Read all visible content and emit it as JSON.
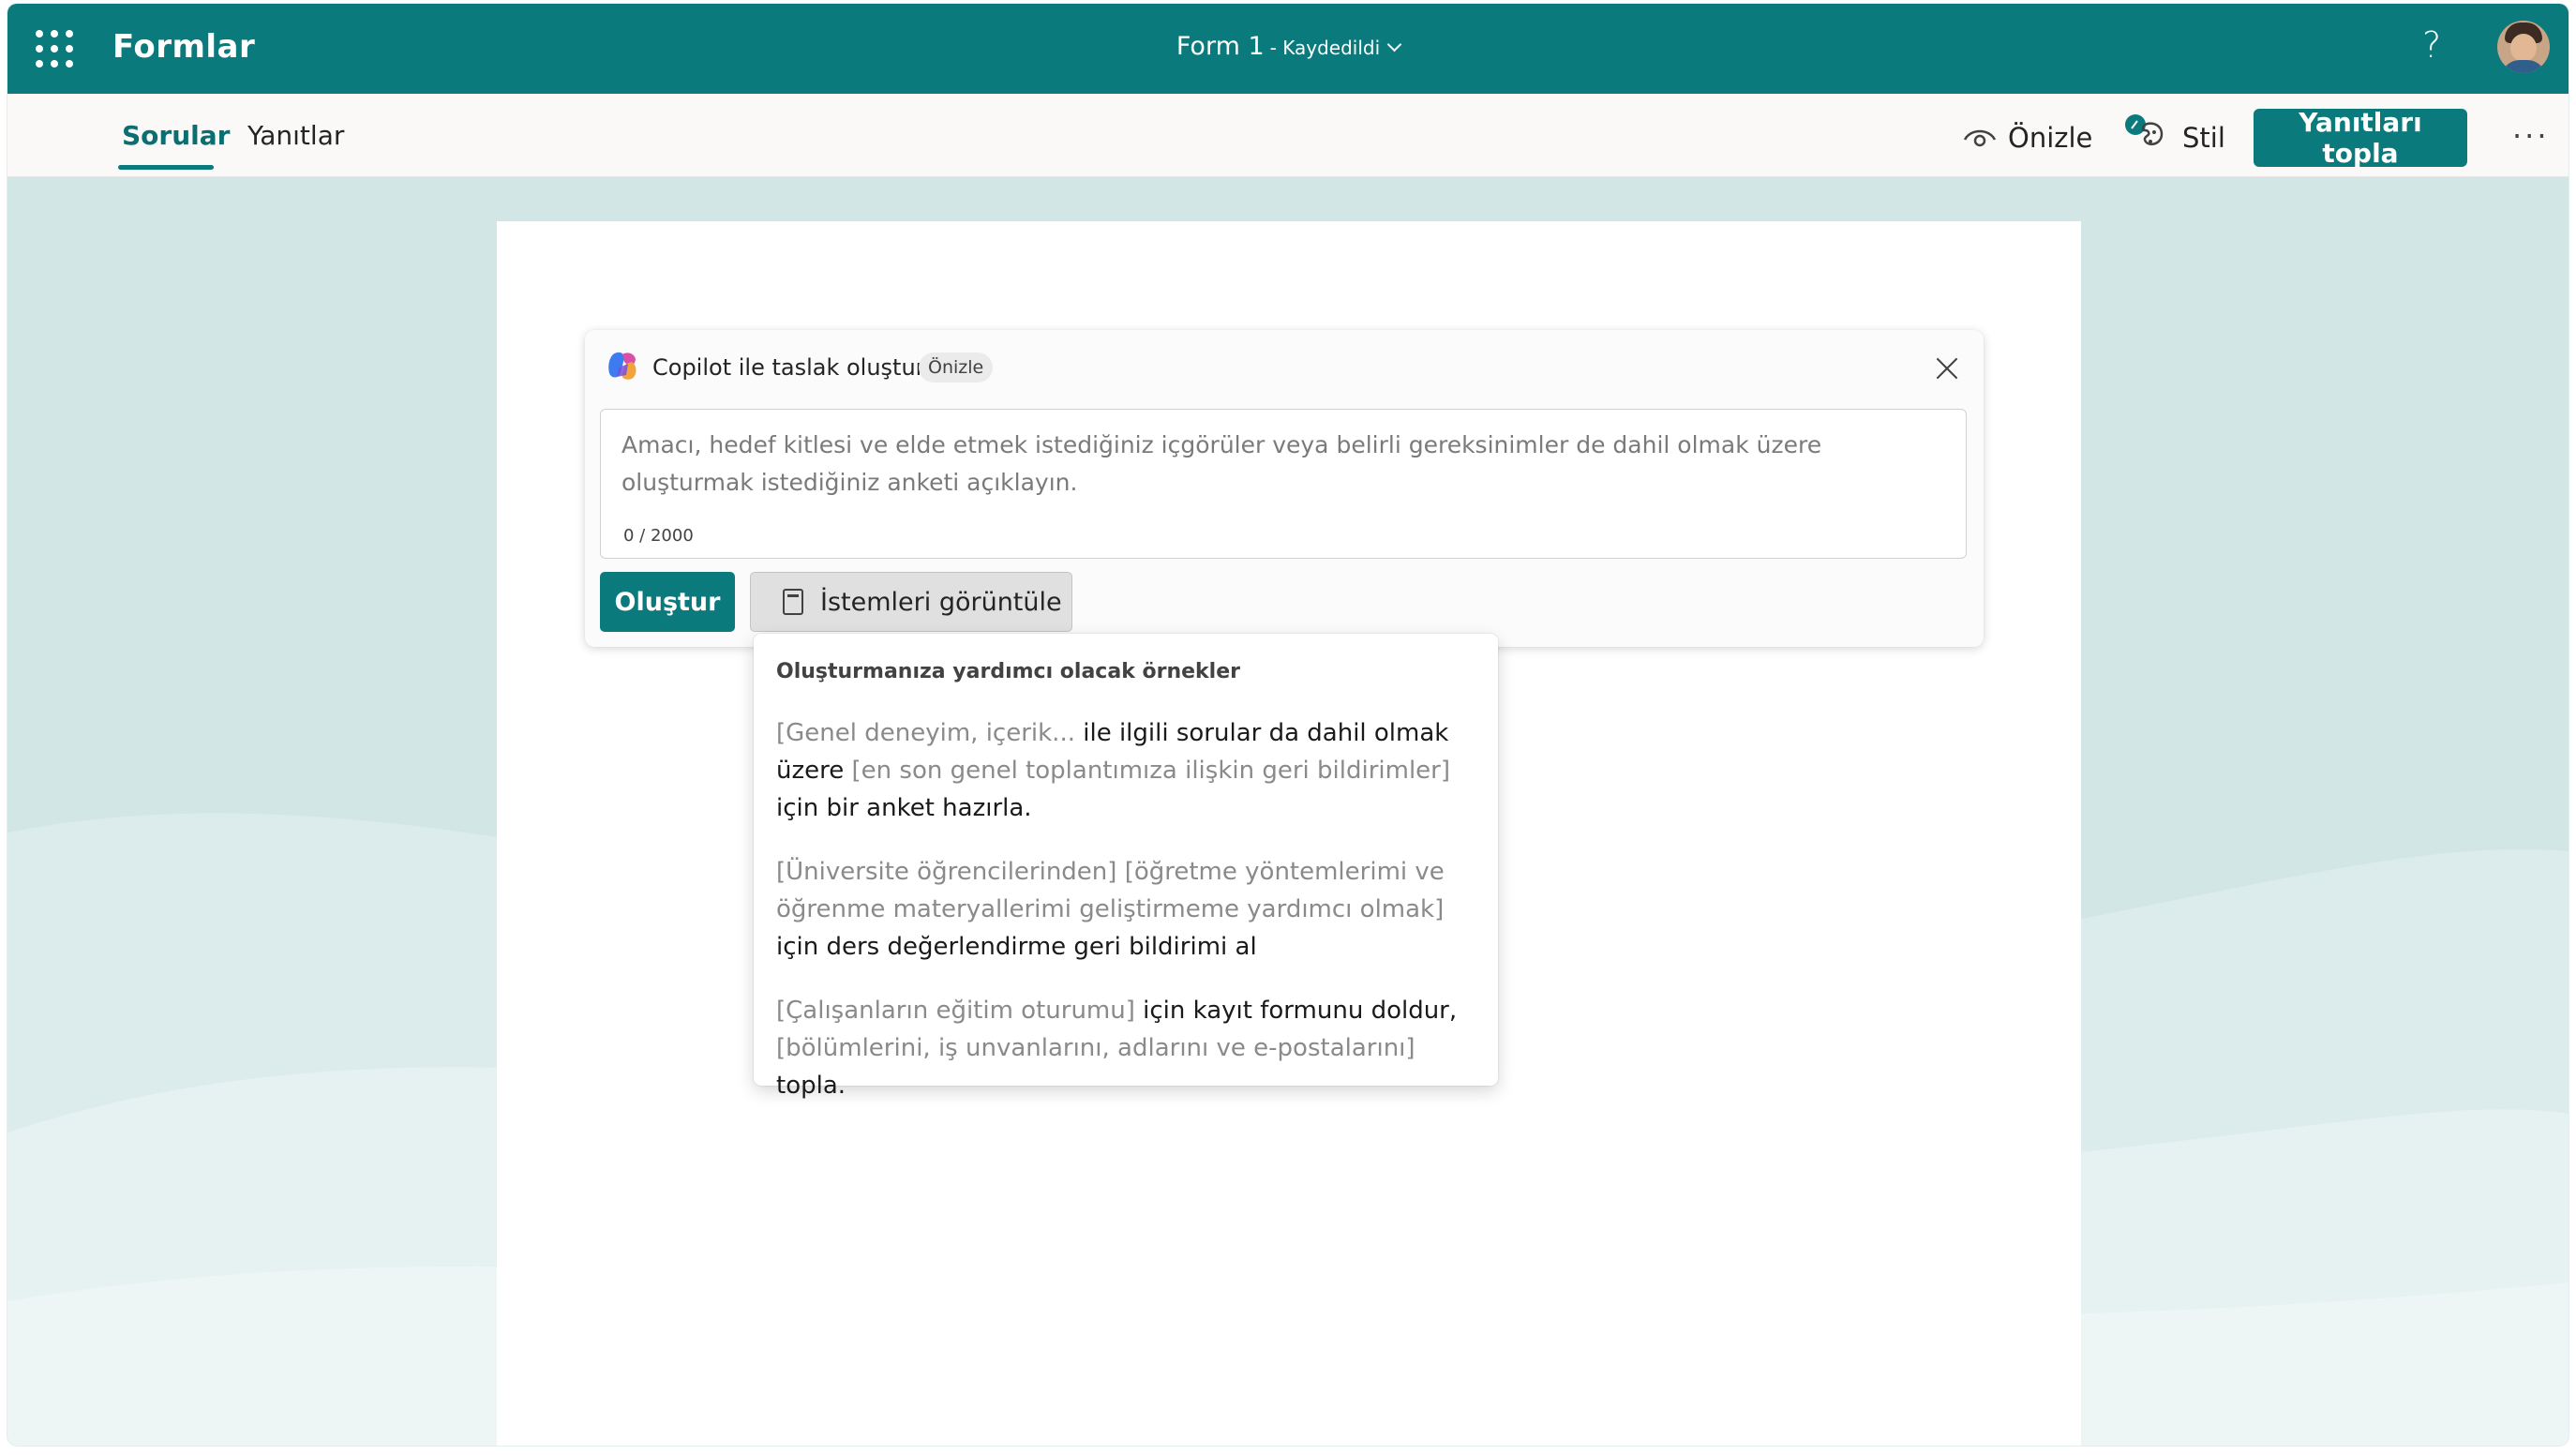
{
  "header": {
    "app_name": "Formlar",
    "form_title": "Form 1",
    "save_status": "- Kaydedildi",
    "help_label": "?"
  },
  "tabs": [
    {
      "label": "Sorular",
      "active": true
    },
    {
      "label": "Yanıtlar",
      "active": false
    }
  ],
  "toolbar": {
    "preview_label": "Önizle",
    "style_label": "Stil",
    "collect_label": "Yanıtları topla",
    "more_label": "···"
  },
  "copilot": {
    "title": "Copilot ile taslak oluştur",
    "badge": "Önizle",
    "placeholder": "Amacı, hedef kitlesi ve elde etmek istediğiniz içgörüler veya belirli gereksinimler de dahil olmak üzere oluşturmak istediğiniz anketi açıklayın.",
    "counter": "0 / 2000",
    "create_label": "Oluştur",
    "prompts_label": "İstemleri görüntüle"
  },
  "examples": {
    "heading": "Oluşturmanıza yardımcı olacak örnekler",
    "items": [
      {
        "p1": "[Genel deneyim, içerik...",
        "t1": " ile ilgili sorular da dahil olmak üzere ",
        "p2": "[en son genel toplantımıza ilişkin geri bildirimler]",
        "t2": " için bir anket hazırla."
      },
      {
        "p1": "[Üniversite öğrencilerinden] [öğretme yöntemlerimi ve öğrenme materyallerimi geliştirmeme yardımcı olmak]",
        "t1": " için ders değerlendirme geri bildirimi al",
        "p2": "",
        "t2": ""
      },
      {
        "p1": "[Çalışanların eğitim oturumu]",
        "t1": " için kayıt formunu doldur, ",
        "p2": "[bölümlerini, iş unvanlarını, adlarını ve e-postalarını]",
        "t2": " topla."
      }
    ]
  },
  "colors": {
    "brand": "#0b7a7c",
    "background": "#d2e6e6"
  }
}
